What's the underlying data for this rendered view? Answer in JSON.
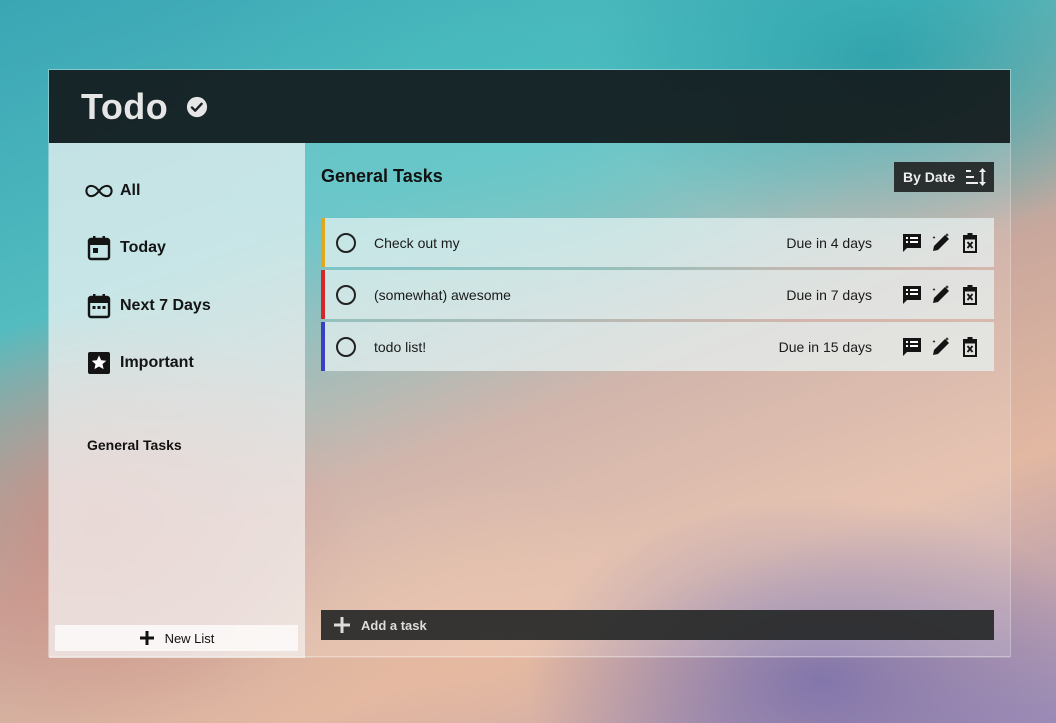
{
  "header": {
    "title": "Todo"
  },
  "sidebar": {
    "items": [
      {
        "label": "All",
        "icon": "infinity-icon"
      },
      {
        "label": "Today",
        "icon": "calendar-today-icon"
      },
      {
        "label": "Next 7 Days",
        "icon": "calendar-week-icon"
      },
      {
        "label": "Important",
        "icon": "star-box-icon"
      }
    ],
    "lists": [
      {
        "label": "General Tasks"
      }
    ],
    "new_list_label": "New List"
  },
  "main": {
    "title": "General Tasks",
    "sort_label": "By Date",
    "tasks": [
      {
        "name": "Check out my",
        "due": "Due in 4 days",
        "accent": "#e0a81c"
      },
      {
        "name": "(somewhat) awesome",
        "due": "Due in 7 days",
        "accent": "#d7262a"
      },
      {
        "name": "todo list!",
        "due": "Due in 15 days",
        "accent": "#3b3fc4"
      }
    ],
    "add_task_label": "Add a task"
  }
}
